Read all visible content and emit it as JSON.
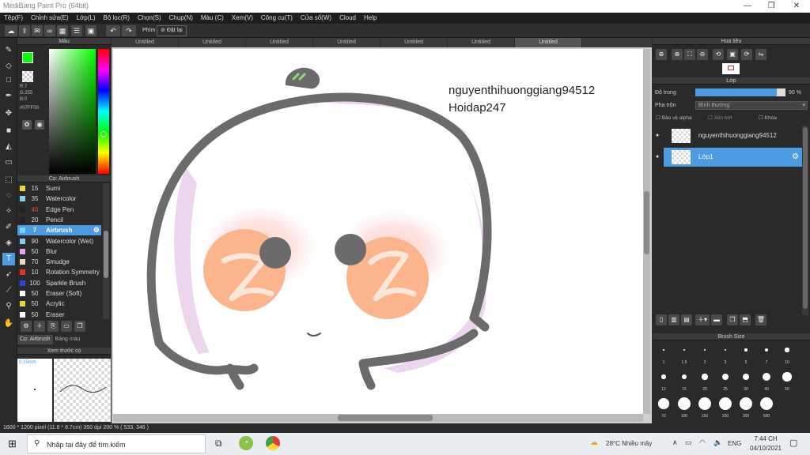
{
  "window": {
    "title": "MediBang Paint Pro (64bit)"
  },
  "menu": [
    "Tệp(F)",
    "Chỉnh sửa(E)",
    "Lớp(L)",
    "Bộ lọc(R)",
    "Chọn(S)",
    "Chụp(N)",
    "Màu (C)",
    "Xem(V)",
    "Công cụ(T)",
    "Cửa sổ(W)",
    "Cloud",
    "Help"
  ],
  "toolbar": {
    "phim_label": "Phím",
    "dat_lai_label": "Đặt lại"
  },
  "color_panel": {
    "title": "Màu",
    "rgb": "R:7\nG:255\nB:0",
    "hex": "#07FF00",
    "fg": "#07ff00",
    "bg": "#000000"
  },
  "brush_panel": {
    "title": "Cọ: Airbrush",
    "items": [
      {
        "size": "15",
        "name": "Sumi",
        "color": "#e8d830"
      },
      {
        "size": "35",
        "name": "Watercolor",
        "color": "#7fd0f0"
      },
      {
        "size": "40",
        "name": "Edge Pen",
        "color": "#222222",
        "size_red": true
      },
      {
        "size": "20",
        "name": "Pencil",
        "color": "#222222"
      },
      {
        "size": "7",
        "name": "Airbrush",
        "color": "#7fd0f0",
        "selected": true
      },
      {
        "size": "90",
        "name": "Watercolor (Wet)",
        "color": "#7fd0f0"
      },
      {
        "size": "50",
        "name": "Blur",
        "color": "#f0a0f0"
      },
      {
        "size": "70",
        "name": "Smudge",
        "color": "#f0d8b8"
      },
      {
        "size": "10",
        "name": "Rotation Symmetry",
        "color": "#e03030"
      },
      {
        "size": "100",
        "name": "Sparkle Brush",
        "color": "#3040e0"
      },
      {
        "size": "50",
        "name": "Eraser (Soft)",
        "color": "#ffffff"
      },
      {
        "size": "50",
        "name": "Acrylic",
        "color": "#e8d830"
      },
      {
        "size": "50",
        "name": "Eraser",
        "color": "#ffffff"
      }
    ],
    "tab1": "Cọ: Airbrush",
    "tab2": "Bảng màu"
  },
  "preview_panel": {
    "title": "Xem trước cọ",
    "size": "0.15mm"
  },
  "doc_tabs": [
    "Untitled",
    "Untitled",
    "Untitled",
    "Untitled",
    "Untitled",
    "Untitled",
    "Untitled"
  ],
  "canvas": {
    "text1": "nguyenthihuonggiang94512",
    "text2": "Hoidap247"
  },
  "nav_panel": {
    "title": "Hoa tiêu"
  },
  "layer_panel": {
    "title": "Lớp",
    "opacity_label": "Độ trong",
    "opacity_value": "90 %",
    "opacity": 0.9,
    "blend_label": "Pha trộn",
    "blend_value": "Bình thường",
    "cb1": "Bảo vệ alpha",
    "cb2": "Xén bớt",
    "cb3": "Khóa",
    "layers": [
      {
        "name": "nguyenthihuonggiang94512"
      },
      {
        "name": "Lớp1",
        "selected": true
      }
    ]
  },
  "brush_size_panel": {
    "title": "Brush Size",
    "sizes": [
      "1",
      "1.5",
      "2",
      "3",
      "5",
      "7",
      "10",
      "12",
      "15",
      "20",
      "25",
      "30",
      "40",
      "50",
      "70",
      "100",
      "150",
      "200",
      "300",
      "500"
    ]
  },
  "statusbar": {
    "text": "1600 * 1200 pixel   (11.6 * 8.7cm)   350 dpi   200 %   ( 533, 346 )"
  },
  "taskbar": {
    "search": "Nhập tại đây để tìm kiếm",
    "weather": "28°C  Nhiều mây",
    "lang": "ENG",
    "time": "7:44 CH",
    "date": "04/10/2021"
  }
}
